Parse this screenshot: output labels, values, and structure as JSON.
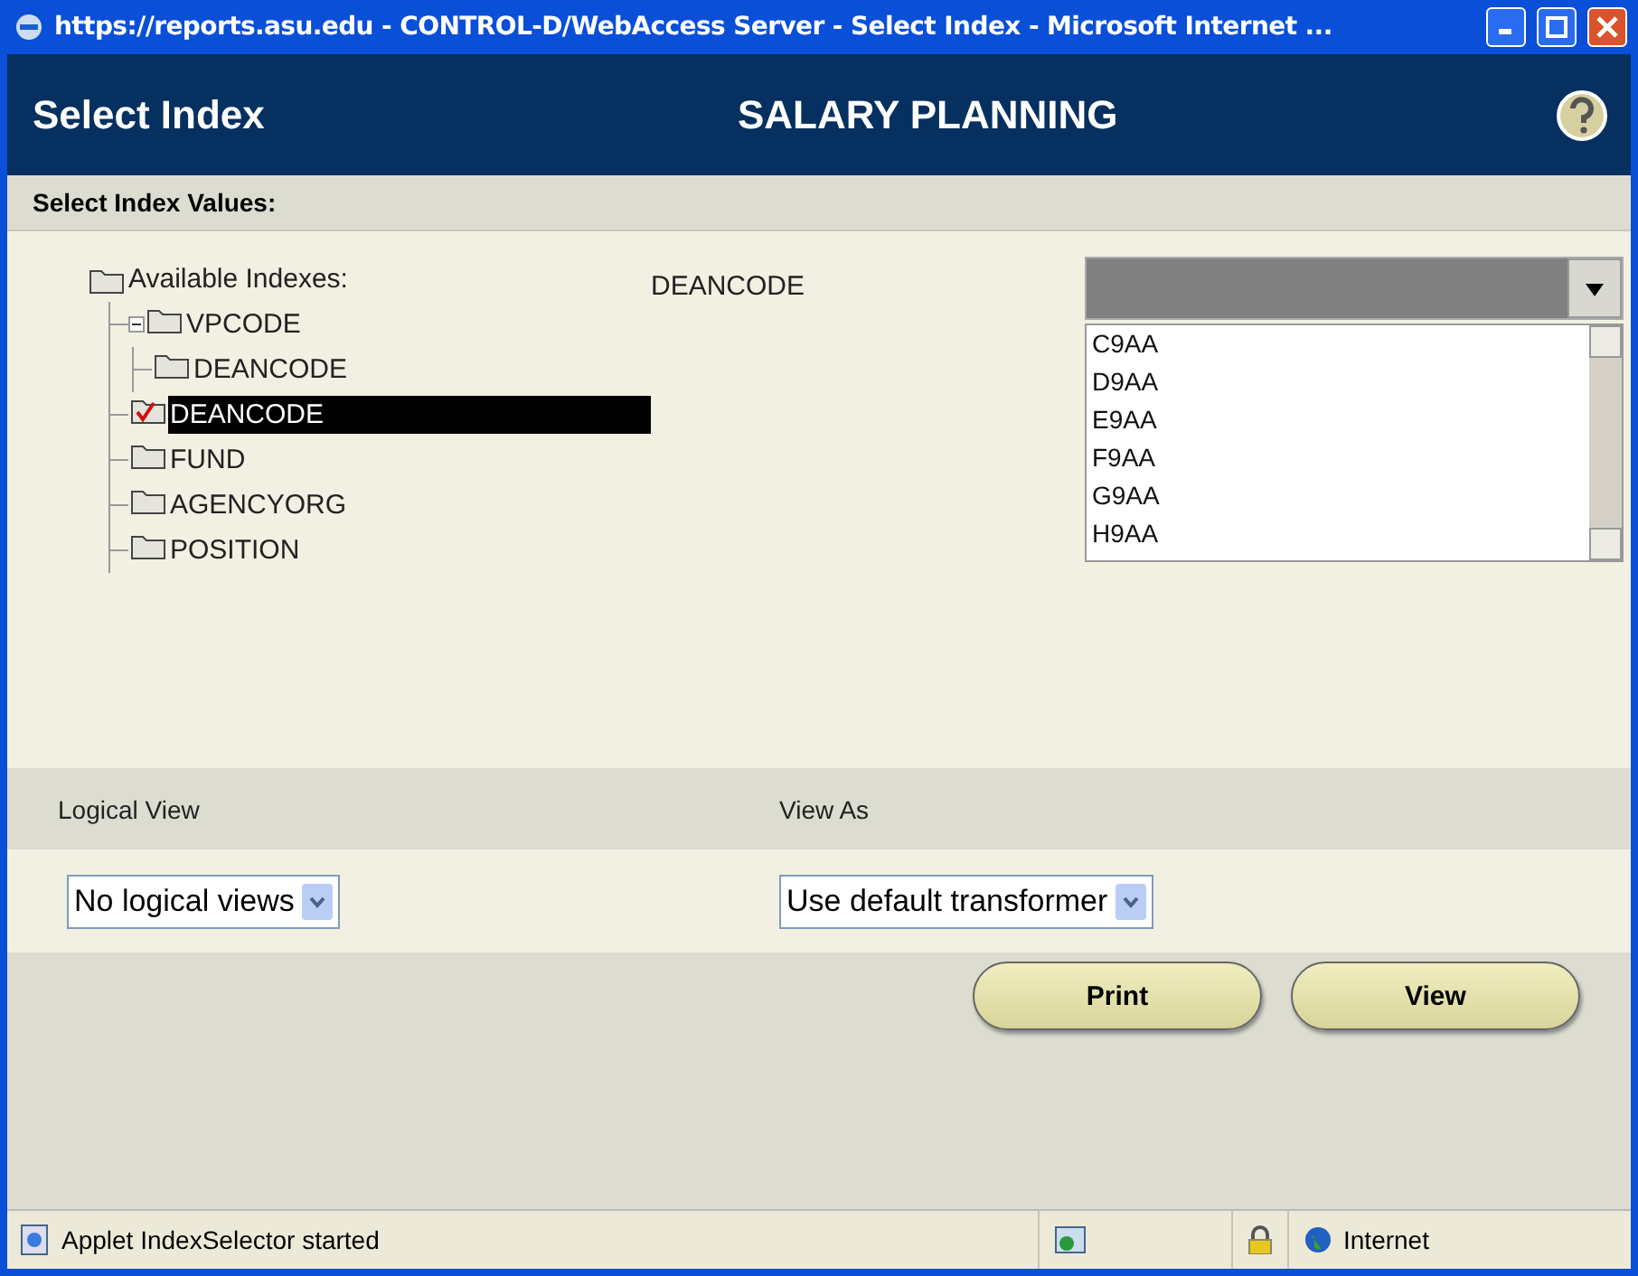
{
  "window": {
    "title": "https://reports.asu.edu - CONTROL-D/WebAccess Server - Select Index - Microsoft Internet ..."
  },
  "header": {
    "title": "Select Index",
    "subtitle": "SALARY PLANNING"
  },
  "section_title": "Select Index Values:",
  "tree": {
    "label": "Available Indexes:",
    "children": [
      {
        "label": "VPCODE",
        "selected": false,
        "checked": false,
        "expanded": true,
        "children": [
          {
            "label": "DEANCODE",
            "selected": false,
            "checked": false
          }
        ]
      },
      {
        "label": "DEANCODE",
        "selected": true,
        "checked": true
      },
      {
        "label": "FUND",
        "selected": false,
        "checked": false
      },
      {
        "label": "AGENCYORG",
        "selected": false,
        "checked": false
      },
      {
        "label": "POSITION",
        "selected": false,
        "checked": false
      }
    ]
  },
  "index_label": "DEANCODE",
  "values": [
    "C9AA",
    "D9AA",
    "E9AA",
    "F9AA",
    "G9AA",
    "H9AA"
  ],
  "logical_view": {
    "label": "Logical View",
    "value": "No logical views"
  },
  "view_as": {
    "label": "View As",
    "value": "Use default transformer"
  },
  "buttons": [
    "Print",
    "View"
  ],
  "status_bar": {
    "message": "Applet IndexSelector started",
    "zone": "Internet"
  }
}
